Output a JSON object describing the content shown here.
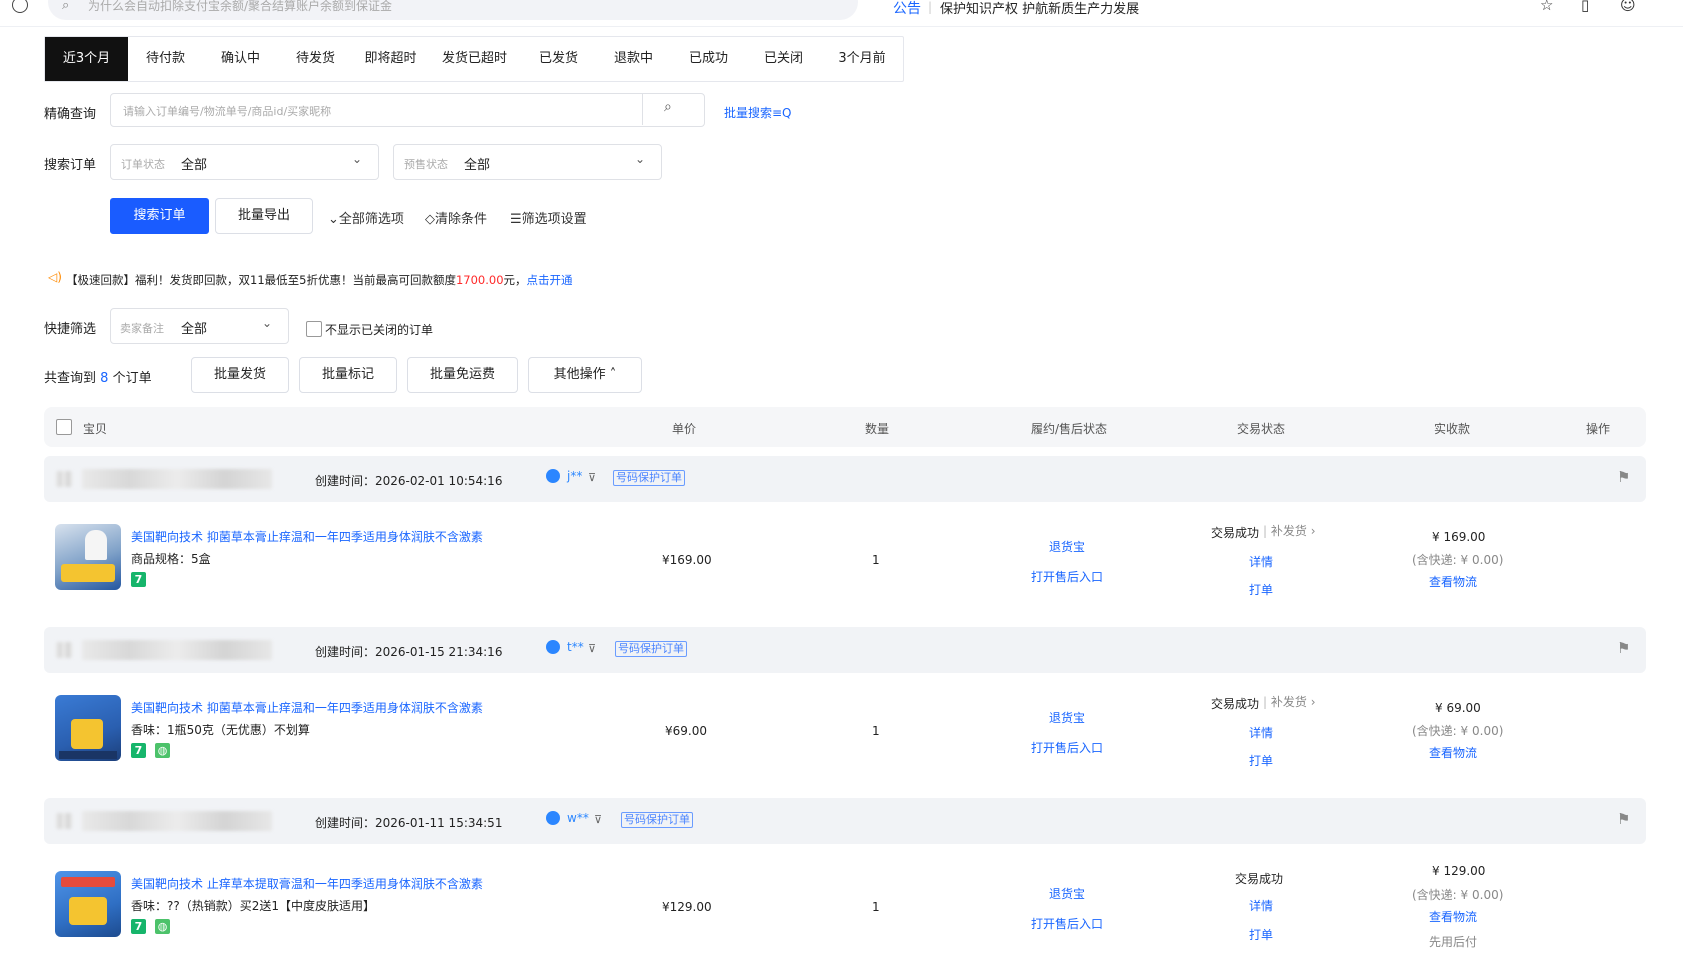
{
  "topbar": {
    "search_placeholder": "为什么会自动扣除支付宝余额/聚合结算账户余额到保证金",
    "notice_tag": "公告",
    "notice_text": "保护知识产权 护航新质生产力发展"
  },
  "tabs": [
    "近3个月",
    "待付款",
    "确认中",
    "待发货",
    "即将超时",
    "发货已超时",
    "已发货",
    "退款中",
    "已成功",
    "已关闭",
    "3个月前"
  ],
  "precise": {
    "label": "精确查询",
    "placeholder": "请输入订单编号/物流单号/商品id/买家昵称",
    "batch_search": "批量搜索≡Q"
  },
  "search_orders": {
    "label": "搜索订单",
    "status_label": "订单状态",
    "status_value": "全部",
    "presale_label": "预售状态",
    "presale_value": "全部"
  },
  "actions": {
    "search_btn": "搜索订单",
    "export_btn": "批量导出",
    "all_filters": "⌄全部筛选项",
    "clear": "◇清除条件",
    "filter_settings": "☰筛选项设置"
  },
  "promo": {
    "text_before": "【极速回款】福利！发货即回款，双11最低至5折优惠！当前最高可回款额度",
    "amount": "1700.00",
    "text_after": "元，",
    "link": "点击开通"
  },
  "quick": {
    "label": "快捷筛选",
    "remark_label": "卖家备注",
    "remark_value": "全部",
    "hide_closed": "不显示已关闭的订单"
  },
  "summary": {
    "prefix": "共查询到",
    "count": "8",
    "suffix": "个订单",
    "batch_ship": "批量发货",
    "batch_mark": "批量标记",
    "batch_free": "批量免运费",
    "other": "其他操作 ˄"
  },
  "table_headers": {
    "item": "宝贝",
    "price": "单价",
    "qty": "数量",
    "fulfill": "履约/售后状态",
    "trade": "交易状态",
    "paid": "实收款",
    "ops": "操作"
  },
  "orders": [
    {
      "created": "创建时间：2026-02-01 10:54:16",
      "buyer": "j**",
      "protect": "号码保护订单",
      "title": "美国靶向技术 抑菌草本膏止痒温和一年四季适用身体润肤不含激素",
      "spec": "商品规格：5盒",
      "price": "¥169.00",
      "qty": "1",
      "refund": "退货宝",
      "aftersale": "打开售后入口",
      "trade": "交易成功",
      "resend": "补发货",
      "detail": "详情",
      "print": "打单",
      "paid": "¥ 169.00",
      "shipping": "(含快递: ¥ 0.00)",
      "logistics": "查看物流"
    },
    {
      "created": "创建时间：2026-01-15 21:34:16",
      "buyer": "t**",
      "protect": "号码保护订单",
      "title": "美国靶向技术 抑菌草本膏止痒温和一年四季适用身体润肤不含激素",
      "spec": "香味：1瓶50克（无优惠）不划算",
      "price": "¥69.00",
      "qty": "1",
      "refund": "退货宝",
      "aftersale": "打开售后入口",
      "trade": "交易成功",
      "resend": "补发货",
      "detail": "详情",
      "print": "打单",
      "paid": "¥ 69.00",
      "shipping": "(含快递: ¥ 0.00)",
      "logistics": "查看物流"
    },
    {
      "created": "创建时间：2026-01-11 15:34:51",
      "buyer": "w**",
      "protect": "号码保护订单",
      "title": "美国靶向技术 止痒草本提取膏温和一年四季适用身体润肤不含激素",
      "spec": "香味：??（热销款）买2送1【中度皮肤适用】",
      "price": "¥129.00",
      "qty": "1",
      "refund": "退货宝",
      "aftersale": "打开售后入口",
      "trade": "交易成功",
      "detail": "详情",
      "print": "打单",
      "paid": "¥ 129.00",
      "shipping": "(含快递: ¥ 0.00)",
      "logistics": "查看物流",
      "later_pay": "先用后付"
    }
  ],
  "colors": {
    "accent": "#1a5cff",
    "link": "#1a66ff",
    "red": "#ff2a2a",
    "active_tab": "#111111"
  }
}
